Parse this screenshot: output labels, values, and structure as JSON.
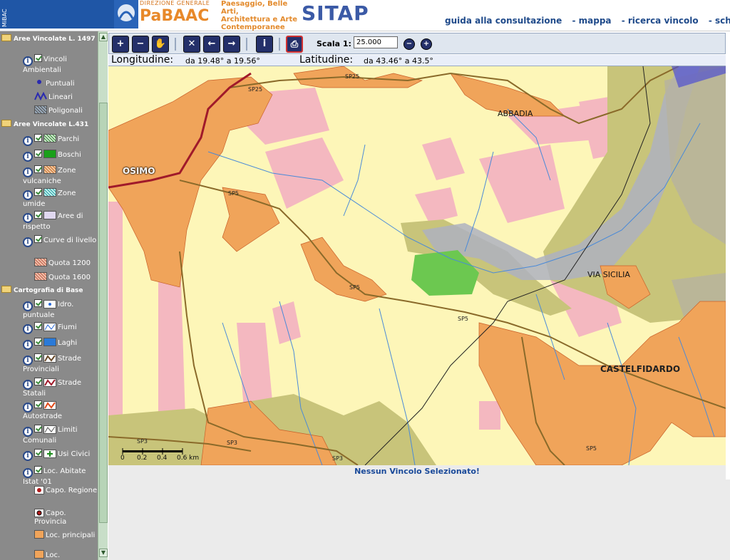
{
  "header": {
    "mibac": "MiBAC",
    "direzione": "DIREZIONE GENERALE",
    "pabaac": "PaBAAC",
    "subtitle_lines": [
      "Paesaggio, Belle Arti,",
      "Architettura e Arte",
      "Contemporanee"
    ],
    "app": "SITAP",
    "nav": [
      "guida alla consultazione",
      "- mappa",
      "- ricerca vincolo",
      "- scheda d"
    ]
  },
  "sidebar": {
    "section1": "Aree Vincolate L. 1497",
    "s1_layer": "Vincoli Ambientali",
    "s1_sub": [
      "Puntuali",
      "Lineari",
      "Poligonali"
    ],
    "section2": "Aree Vincolate L.431",
    "s2_layers": [
      "Parchi",
      "Boschi",
      "Zone vulcaniche",
      "Zone umide",
      "Aree di rispetto",
      "Curve di livello"
    ],
    "s2_sub": [
      "Quota 1200",
      "Quota 1600"
    ],
    "section3": "Cartografia di Base",
    "s3_layers": [
      "Idro. puntuale",
      "Fiumi",
      "Laghi",
      "Strade Provinciali",
      "Strade Statali",
      "Autostrade",
      "Limiti Comunali",
      "Usi Civici",
      "Loc. Abitate Istat '01"
    ],
    "s3_sub": [
      "Capo. Regione",
      "Capo. Provincia",
      "Loc. principali",
      "Loc."
    ]
  },
  "toolbar": {
    "scala_label": "Scala 1:",
    "scala_value": "25.000"
  },
  "coords": {
    "lon_label": "Longitudine:",
    "lon_value": "da 19.48° a 19.56°",
    "lat_label": "Latitudine:",
    "lat_value": "da 43.46° a 43.5°"
  },
  "map": {
    "places": [
      "OSIMO",
      "ABBADIA",
      "VIA SICILIA",
      "CASTELFIDARDO"
    ],
    "roads": [
      "SP25",
      "SP25",
      "SP5",
      "SP5",
      "SP5",
      "SP5",
      "SP3",
      "SP3",
      "SP3"
    ],
    "scalebar": [
      "0",
      "0.2",
      "0.4",
      "0.6 km"
    ]
  },
  "status": "Nessun Vincolo Selezionato!",
  "colors": {
    "map_bg": "#fdf6b8",
    "urban": "#f0a45a",
    "pink": "#f4b8c0",
    "olive": "#c8c47a",
    "green": "#6cc850",
    "river": "#4a8ad8",
    "header_blue": "#1f56a6"
  }
}
